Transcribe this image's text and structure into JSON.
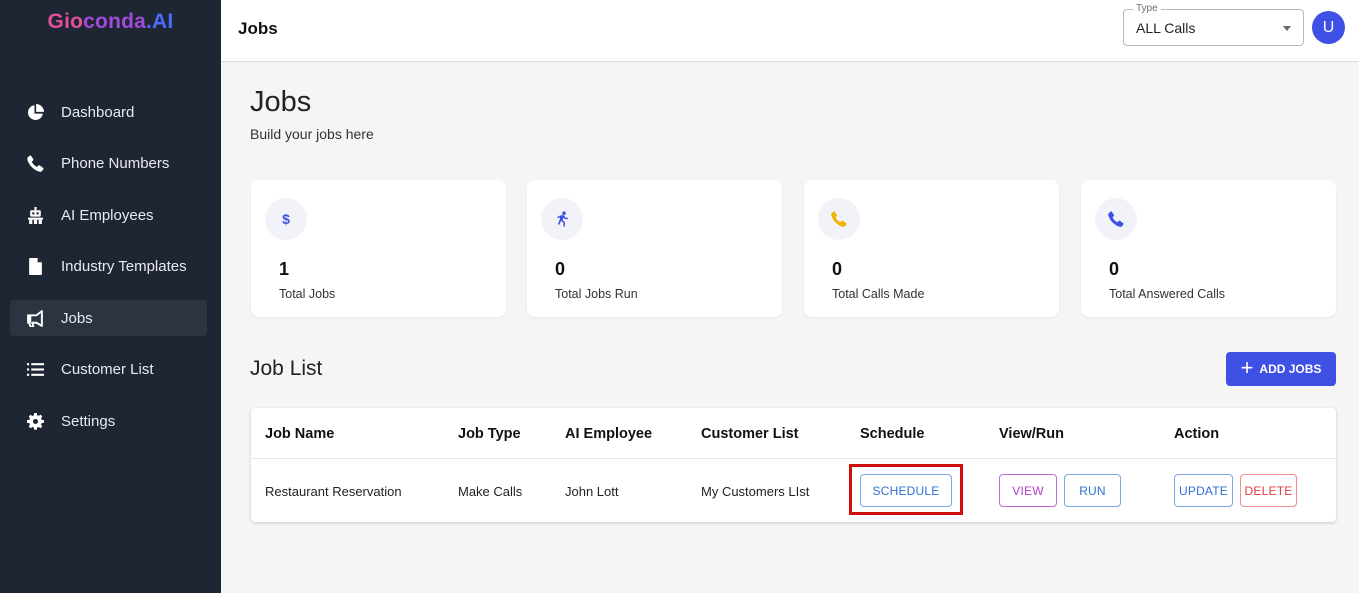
{
  "brand": {
    "part1": "Gio",
    "part2": "conda",
    "part3": ".AI"
  },
  "sidebar": {
    "items": [
      {
        "label": "Dashboard",
        "icon": "pie-chart-icon"
      },
      {
        "label": "Phone Numbers",
        "icon": "phone-icon"
      },
      {
        "label": "AI Employees",
        "icon": "robot-icon"
      },
      {
        "label": "Industry Templates",
        "icon": "file-icon"
      },
      {
        "label": "Jobs",
        "icon": "megaphone-icon",
        "active": true
      },
      {
        "label": "Customer List",
        "icon": "list-icon"
      },
      {
        "label": "Settings",
        "icon": "gear-icon"
      }
    ]
  },
  "header": {
    "title": "Jobs",
    "type_label": "Type",
    "type_value": "ALL Calls",
    "avatar_initial": "U"
  },
  "page": {
    "title": "Jobs",
    "subtitle": "Build your jobs here"
  },
  "stats": [
    {
      "value": "1",
      "label": "Total Jobs",
      "icon": "dollar-icon",
      "color": "#3f51e5"
    },
    {
      "value": "0",
      "label": "Total Jobs Run",
      "icon": "running-icon",
      "color": "#3f51e5"
    },
    {
      "value": "0",
      "label": "Total Calls Made",
      "icon": "phone-icon",
      "color": "#f0b400"
    },
    {
      "value": "0",
      "label": "Total Answered Calls",
      "icon": "phone-icon",
      "color": "#3f51e5"
    }
  ],
  "job_list": {
    "title": "Job List",
    "add_label": "ADD JOBS",
    "columns": [
      "Job Name",
      "Job Type",
      "AI Employee",
      "Customer List",
      "Schedule",
      "View/Run",
      "Action"
    ],
    "rows": [
      {
        "job_name": "Restaurant Reservation",
        "job_type": "Make Calls",
        "ai_employee": "John Lott",
        "customer_list": "My Customers LIst",
        "schedule_label": "SCHEDULE",
        "view_label": "VIEW",
        "run_label": "RUN",
        "update_label": "UPDATE",
        "delete_label": "DELETE"
      }
    ]
  },
  "colors": {
    "sidebar_bg": "#1e2533",
    "accent": "#3f51e5",
    "highlight": "#d10f0f"
  }
}
